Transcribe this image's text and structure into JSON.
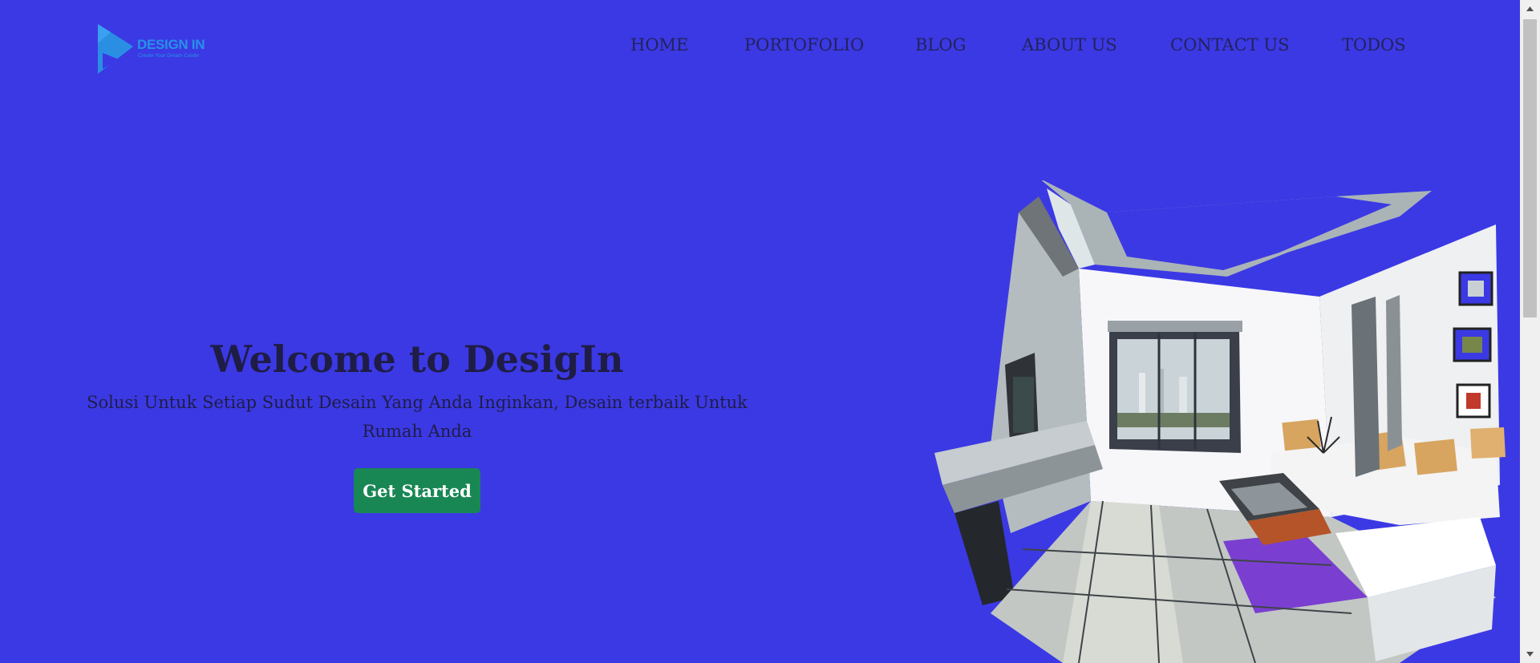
{
  "brand": {
    "name": "DESIGN IN",
    "tagline": "Create Your Dream Castle",
    "color": "#2792e6"
  },
  "nav": {
    "items": [
      {
        "label": "HOME"
      },
      {
        "label": "PORTOFOLIO"
      },
      {
        "label": "BLOG"
      },
      {
        "label": "ABOUT US"
      },
      {
        "label": "CONTACT US"
      },
      {
        "label": "TODOS"
      }
    ]
  },
  "hero": {
    "title": "Welcome to DesigIn",
    "subtitle": "Solusi Untuk Setiap Sudut Desain Yang Anda Inginkan, Desain terbaik Untuk Rumah Anda",
    "cta_label": "Get Started"
  },
  "illustration": {
    "icon": "living-room-sketch"
  },
  "colors": {
    "background": "#3b39e4",
    "text": "#1f1d45",
    "button": "#198754",
    "button_text": "#ffffff"
  }
}
